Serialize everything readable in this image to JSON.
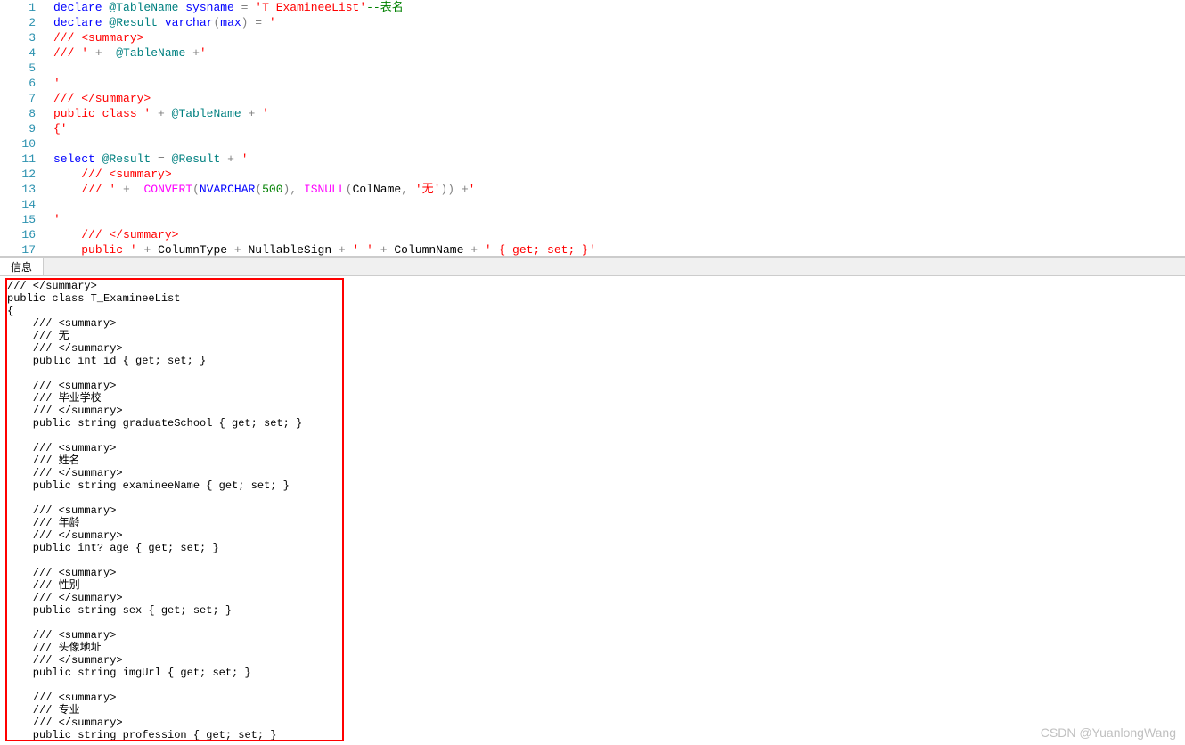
{
  "editor": {
    "lines": [
      {
        "n": 1,
        "html": "<span class='kw'>declare</span> <span class='type'>@TableName</span> <span class='kw'>sysname</span> <span class='gray'>=</span> <span class='str'>'T_ExamineeList'</span><span class='comment'>--表名</span>"
      },
      {
        "n": 2,
        "html": "<span class='kw'>declare</span> <span class='type'>@Result</span> <span class='kw'>varchar</span><span class='gray'>(</span><span class='kw'>max</span><span class='gray'>)</span> <span class='gray'>=</span> <span class='str'>'</span>"
      },
      {
        "n": 3,
        "html": "<span class='str'>/// &lt;summary&gt;</span>"
      },
      {
        "n": 4,
        "html": "<span class='str'>/// '</span> <span class='gray'>+</span>  <span class='type'>@TableName</span> <span class='gray'>+</span><span class='str'>'</span>"
      },
      {
        "n": 5,
        "html": ""
      },
      {
        "n": 6,
        "html": "<span class='str'>'</span>"
      },
      {
        "n": 7,
        "html": "<span class='str'>/// &lt;/summary&gt;</span>"
      },
      {
        "n": 8,
        "html": "<span class='str'>public class '</span> <span class='gray'>+</span> <span class='type'>@TableName</span> <span class='gray'>+</span> <span class='str'>'</span>"
      },
      {
        "n": 9,
        "html": "<span class='str'>{'</span>"
      },
      {
        "n": 10,
        "html": ""
      },
      {
        "n": 11,
        "html": "<span class='kw'>select</span> <span class='type'>@Result</span> <span class='gray'>=</span> <span class='type'>@Result</span> <span class='gray'>+</span> <span class='str'>'</span>"
      },
      {
        "n": 12,
        "html": "    <span class='str'>/// &lt;summary&gt;</span>"
      },
      {
        "n": 13,
        "html": "    <span class='str'>/// '</span> <span class='gray'>+</span>  <span class='func'>CONVERT</span><span class='gray'>(</span><span class='kw'>NVARCHAR</span><span class='gray'>(</span><span class='num'>500</span><span class='gray'>),</span> <span class='func'>ISNULL</span><span class='gray'>(</span>ColName<span class='gray'>,</span> <span class='str'>'无'</span><span class='gray'>))</span> <span class='gray'>+</span><span class='str'>'</span>"
      },
      {
        "n": 14,
        "html": ""
      },
      {
        "n": 15,
        "html": "<span class='str'>'</span>"
      },
      {
        "n": 16,
        "html": "    <span class='str'>/// &lt;/summary&gt;</span>"
      },
      {
        "n": 17,
        "html": "    <span class='str'>public '</span> <span class='gray'>+</span> ColumnType <span class='gray'>+</span> NullableSign <span class='gray'>+</span> <span class='str'>' '</span> <span class='gray'>+</span> ColumnName <span class='gray'>+</span> <span class='str'>' { get; set; }'</span>"
      }
    ]
  },
  "tabs": {
    "label": "信息"
  },
  "output": {
    "text": "/// </summary>\npublic class T_ExamineeList\n{\n    /// <summary>\n    /// 无\n    /// </summary>\n    public int id { get; set; }\n\n    /// <summary>\n    /// 毕业学校\n    /// </summary>\n    public string graduateSchool { get; set; }\n\n    /// <summary>\n    /// 姓名\n    /// </summary>\n    public string examineeName { get; set; }\n\n    /// <summary>\n    /// 年龄\n    /// </summary>\n    public int? age { get; set; }\n\n    /// <summary>\n    /// 性别\n    /// </summary>\n    public string sex { get; set; }\n\n    /// <summary>\n    /// 头像地址\n    /// </summary>\n    public string imgUrl { get; set; }\n\n    /// <summary>\n    /// 专业\n    /// </summary>\n    public string profession { get; set; }\n"
  },
  "watermark": "CSDN @YuanlongWang"
}
